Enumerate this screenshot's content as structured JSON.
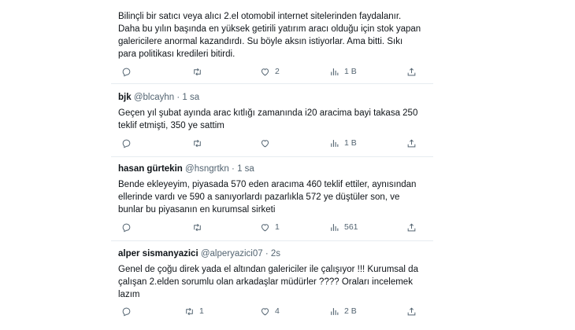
{
  "tweets": [
    {
      "name": "",
      "handle": "",
      "dot": "",
      "time": "",
      "lines": [
        "Bilinçli bir satıcı veya alıcı 2.el otomobil internet sitelerinden faydalanır.",
        "Daha bu yılın başında en yüksek getirili yatırım aracı olduğu için stok yapan",
        "galericilere anormal kazandırdı. Su böyle aksın istiyorlar. Ama bitti. Sıkı",
        "para politikası kredileri bitirdi."
      ],
      "counts": {
        "reply": "",
        "retweet": "",
        "like": "2",
        "views": "1 B"
      }
    },
    {
      "name": "bjk",
      "handle": "@blcayhn",
      "dot": "·",
      "time": "1 sa",
      "lines": [
        "Geçen yıl şubat ayında arac kıtlığı zamanında i20 aracima bayi takasa 250",
        "teklif etmişti, 350 ye sattim"
      ],
      "counts": {
        "reply": "",
        "retweet": "",
        "like": "",
        "views": "1 B"
      }
    },
    {
      "name": "hasan gürtekin",
      "handle": "@hsngrtkn",
      "dot": "·",
      "time": "1 sa",
      "lines": [
        "Bende ekleyeyim, piyasada 570 eden aracıma 460 teklif ettiler, aynısından",
        "ellerinde vardı ve 590 a sanıyorlardı pazarlıkla 572 ye düştüler son, ve",
        "bunlar bu piyasanın en kurumsal sirketi"
      ],
      "counts": {
        "reply": "",
        "retweet": "",
        "like": "1",
        "views": "561"
      }
    },
    {
      "name": "alper sismanyazici",
      "handle": "@alperyazici07",
      "dot": "·",
      "time": "2s",
      "lines": [
        "Genel de çoğu direk yada el altından galericiler ile çalışıyor !!!  Kurumsal da",
        "çalışan 2.elden sorumlu olan arkadaşlar müdürler ????  Oraları incelemek",
        "lazım"
      ],
      "counts": {
        "reply": "",
        "retweet": "1",
        "like": "4",
        "views": "2 B"
      }
    }
  ],
  "icons": [
    "reply-icon",
    "retweet-icon",
    "like-icon",
    "views-icon",
    "share-icon"
  ],
  "colors": {
    "text": "#0f1419",
    "secondary": "#536471",
    "divider": "#e6ecf0"
  }
}
